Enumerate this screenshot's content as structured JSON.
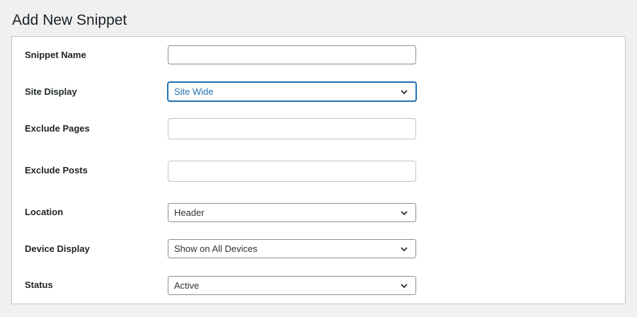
{
  "page": {
    "title": "Add New Snippet"
  },
  "form": {
    "snippet_name": {
      "label": "Snippet Name",
      "value": ""
    },
    "site_display": {
      "label": "Site Display",
      "selected": "Site Wide"
    },
    "exclude_pages": {
      "label": "Exclude Pages",
      "value": ""
    },
    "exclude_posts": {
      "label": "Exclude Posts",
      "value": ""
    },
    "location": {
      "label": "Location",
      "selected": "Header"
    },
    "device_display": {
      "label": "Device Display",
      "selected": "Show on All Devices"
    },
    "status": {
      "label": "Status",
      "selected": "Active"
    }
  },
  "colors": {
    "accent": "#2271b1",
    "background": "#f0f0f1",
    "panel": "#ffffff",
    "border": "#8c8f94"
  },
  "icons": {
    "select_arrow": "chevron-down-icon"
  }
}
